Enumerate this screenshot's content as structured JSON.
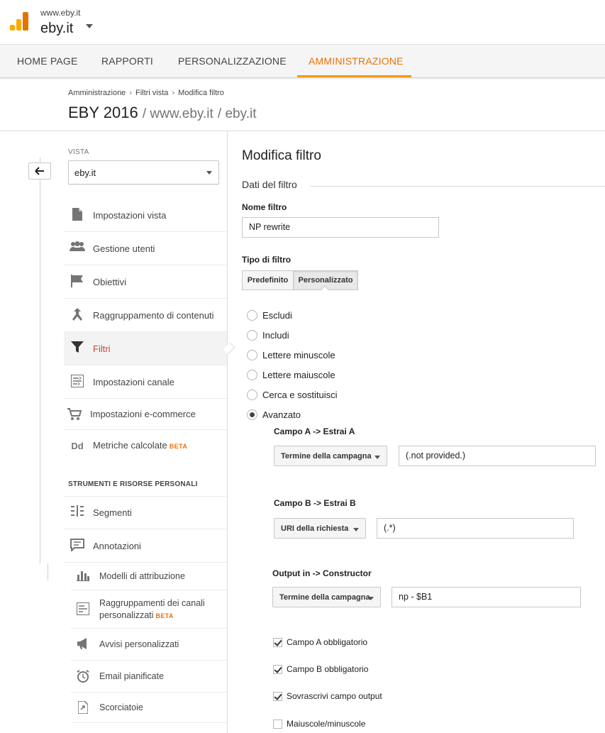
{
  "account": {
    "url": "www.eby.it",
    "name": "eby.it"
  },
  "nav": {
    "tabs": [
      "HOME PAGE",
      "RAPPORTI",
      "PERSONALIZZAZIONE",
      "AMMINISTRAZIONE"
    ],
    "active": "AMMINISTRAZIONE"
  },
  "breadcrumb": {
    "items": [
      "Amministrazione",
      "Filtri vista",
      "Modifica filtro"
    ],
    "separator": "›"
  },
  "page": {
    "title": "EBY 2016",
    "path1": "/ www.eby.it",
    "path2": "/ eby.it"
  },
  "sidebar": {
    "vista_label": "VISTA",
    "vista_value": "eby.it",
    "items": [
      {
        "label": "Impostazioni vista",
        "icon": "document-icon"
      },
      {
        "label": "Gestione utenti",
        "icon": "users-icon"
      },
      {
        "label": "Obiettivi",
        "icon": "flag-icon"
      },
      {
        "label": "Raggruppamento di contenuti",
        "icon": "merge-icon"
      },
      {
        "label": "Filtri",
        "icon": "filter-icon",
        "selected": true
      },
      {
        "label": "Impostazioni canale",
        "icon": "channel-settings-icon"
      },
      {
        "label": "Impostazioni e-commerce",
        "icon": "cart-icon"
      },
      {
        "label": "Metriche calcolate",
        "icon": "calculated-metrics-icon",
        "badge": "BETA"
      }
    ],
    "section_head": "STRUMENTI E RISORSE PERSONALI",
    "tools": [
      {
        "label": "Segmenti",
        "icon": "segments-icon"
      },
      {
        "label": "Annotazioni",
        "icon": "annotation-icon"
      }
    ],
    "sub_items": [
      {
        "label": "Modelli di attribuzione",
        "icon": "bar-chart-icon"
      },
      {
        "label": "Raggruppamenti dei canali",
        "label2": "personalizzati",
        "icon": "channel-group-icon",
        "badge": "BETA"
      },
      {
        "label": "Avvisi personalizzati",
        "icon": "megaphone-icon"
      },
      {
        "label": "Email pianificate",
        "icon": "alarm-clock-icon"
      },
      {
        "label": "Scorciatoie",
        "icon": "shortcut-icon"
      }
    ]
  },
  "form": {
    "title": "Modifica filtro",
    "section": "Dati del filtro",
    "name_label": "Nome filtro",
    "name_value": "NP rewrite",
    "type_label": "Tipo di filtro",
    "type_tabs": [
      "Predefinito",
      "Personalizzato"
    ],
    "type_active": "Personalizzato",
    "radios": [
      "Escludi",
      "Includi",
      "Lettere minuscole",
      "Lettere maiuscole",
      "Cerca e sostituisci",
      "Avanzato"
    ],
    "radio_selected": "Avanzato",
    "field_a": {
      "label": "Campo A -> Estrai A",
      "select": "Termine della campagna",
      "value": "(.not provided.)"
    },
    "field_b": {
      "label": "Campo B -> Estrai B",
      "select": "URI della richiesta",
      "value": "(.*)"
    },
    "output": {
      "label": "Output in -> Constructor",
      "select": "Termine della campagna",
      "value": "np - $B1"
    },
    "checks": [
      {
        "label": "Campo A obbligatorio",
        "checked": true
      },
      {
        "label": "Campo B obbligatorio",
        "checked": true
      },
      {
        "label": "Sovrascrivi campo output",
        "checked": true
      },
      {
        "label": "Maiuscole/minuscole",
        "checked": false
      }
    ]
  }
}
